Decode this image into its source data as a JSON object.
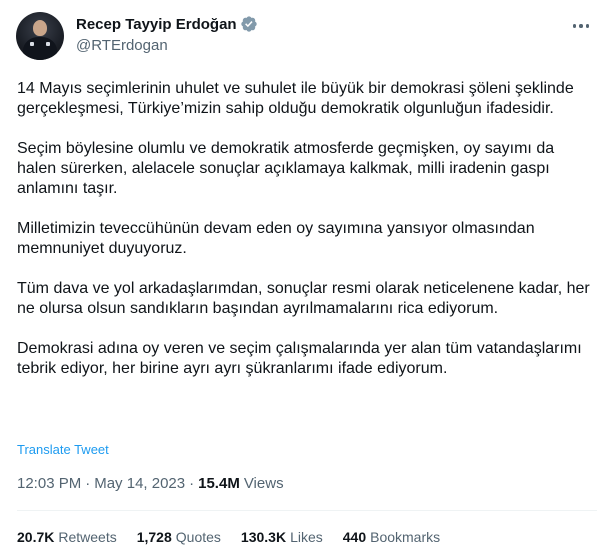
{
  "author": {
    "display_name": "Recep Tayyip Erdoğan",
    "handle": "@RTErdogan",
    "verified": true
  },
  "tweet": {
    "paragraphs": [
      "14 Mayıs seçimlerinin uhulet ve suhulet ile büyük bir demokrasi şöleni şeklinde gerçekleşmesi, Türkiye’mizin sahip olduğu demokratik olgunluğun ifadesidir.",
      "Seçim böylesine olumlu ve demokratik atmosferde geçmişken, oy sayımı da halen sürerken, alelacele sonuçlar açıklamaya kalkmak, milli iradenin gaspı anlamını taşır.",
      "Milletimizin teveccühünün devam eden oy sayımına yansıyor olmasından memnuniyet duyuyoruz.",
      "Tüm dava ve yol arkadaşlarımdan, sonuçlar resmi olarak neticelenene kadar, her ne olursa olsun sandıkların başından ayrılmamalarını rica ediyorum.",
      "Demokrasi adına oy veren ve seçim çalışmalarında yer alan tüm vatandaşlarımı tebrik ediyor, her birine ayrı ayrı şükranlarımı ifade ediyorum."
    ],
    "translate_label": "Translate Tweet",
    "time": "12:03 PM",
    "separator": "·",
    "date": "May 14, 2023",
    "views_count": "15.4M",
    "views_label": "Views"
  },
  "stats": {
    "retweets": {
      "count": "20.7K",
      "label": "Retweets"
    },
    "quotes": {
      "count": "1,728",
      "label": "Quotes"
    },
    "likes": {
      "count": "130.3K",
      "label": "Likes"
    },
    "bookmarks": {
      "count": "440",
      "label": "Bookmarks"
    }
  },
  "colors": {
    "accent": "#1d9bf0",
    "text": "#0f1419",
    "secondary": "#536471",
    "divider": "#eff3f4"
  }
}
